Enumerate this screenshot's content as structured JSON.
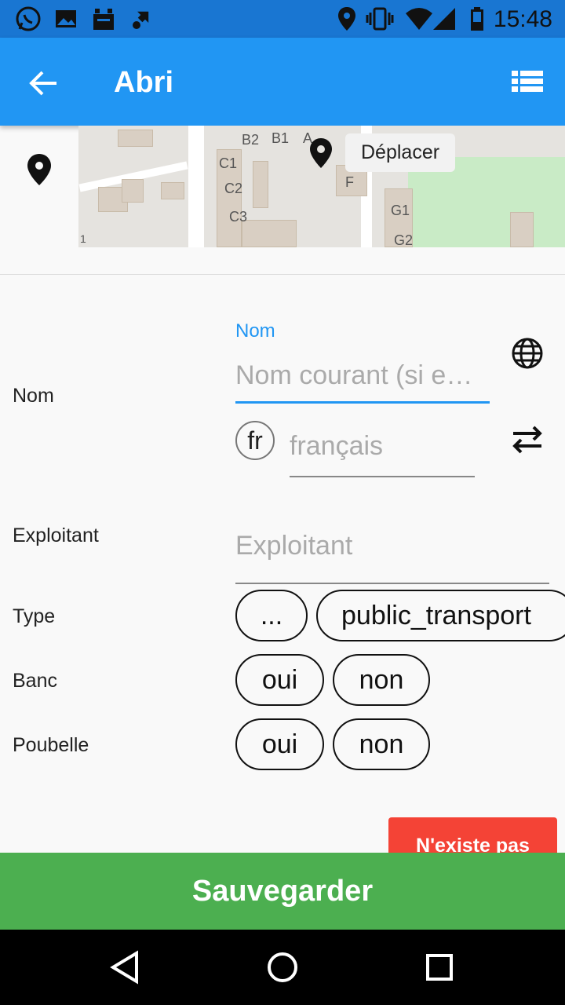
{
  "status_bar": {
    "time": "15:48",
    "icons": [
      "whatsapp-icon",
      "image-icon",
      "android-icon",
      "sync-icon",
      "location-icon",
      "vibrate-icon",
      "wifi-icon",
      "signal-icon",
      "battery-icon"
    ]
  },
  "app_bar": {
    "title": "Abri",
    "back_icon": "arrow-back-icon",
    "list_icon": "list-icon"
  },
  "map": {
    "move_button_label": "Déplacer",
    "labels": [
      "B2",
      "B1",
      "A",
      "C1",
      "C2",
      "C3",
      "F",
      "G1",
      "G2",
      "1"
    ]
  },
  "form": {
    "nom": {
      "label": "Nom",
      "field_label": "Nom",
      "placeholder": "Nom courant (si e…",
      "language_code": "fr",
      "language_placeholder": "français"
    },
    "exploitant": {
      "label": "Exploitant",
      "placeholder": "Exploitant"
    },
    "type": {
      "label": "Type",
      "options": [
        "...",
        "public_transport"
      ]
    },
    "banc": {
      "label": "Banc",
      "options": [
        "oui",
        "non"
      ]
    },
    "poubelle": {
      "label": "Poubelle",
      "options": [
        "oui",
        "non"
      ]
    }
  },
  "buttons": {
    "not_exist": "N'existe pas",
    "save": "Sauvegarder"
  },
  "colors": {
    "primary": "#2196f3",
    "status_bar": "#1976d2",
    "save": "#4caf50",
    "danger": "#f44336"
  }
}
